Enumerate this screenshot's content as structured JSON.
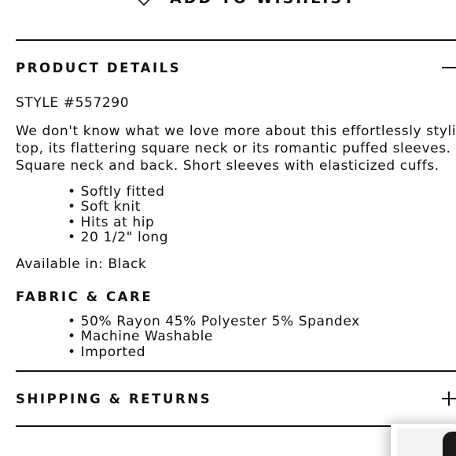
{
  "wishlist": {
    "label": "ADD TO WISHLIST",
    "icon": "heart-icon"
  },
  "product_details": {
    "title": "PRODUCT DETAILS",
    "toggle_icon": "minus-icon",
    "expanded": true,
    "style": "STYLE #557290",
    "description": "We don't know what we love more about this effortlessly stylish top, its flattering square neck or its romantic puffed sleeves. Square neck and back. Short sleeves with elasticized cuffs.",
    "bullets": [
      "Softly fitted",
      "Soft knit",
      "Hits at hip",
      "20 1/2\" long"
    ],
    "available": "Available in: Black"
  },
  "fabric_care": {
    "title": "FABRIC & CARE",
    "bullets": [
      "50% Rayon 45% Polyester 5% Spandex",
      "Machine Washable",
      "Imported"
    ]
  },
  "shipping_returns": {
    "title": "SHIPPING & RETURNS",
    "toggle_icon": "plus-icon",
    "expanded": false
  },
  "colors": {
    "text": "#111111",
    "background": "#ffffff"
  }
}
